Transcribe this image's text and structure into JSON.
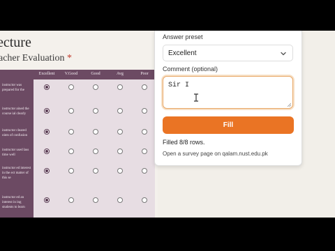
{
  "survey": {
    "title": "ecture",
    "subtitle": "acher Evaluation",
    "required_mark": "*",
    "columns": [
      "Excellent",
      "V.Good",
      "Good",
      "Avg",
      "Poor"
    ],
    "questions": [
      {
        "text": "instructor was prepared for the",
        "selected": "Excellent"
      },
      {
        "text": "instructor ained the course ial clearly",
        "selected": "Excellent"
      },
      {
        "text": "instructor cleared oints of confusion",
        "selected": "Excellent"
      },
      {
        "text": "instructor used lass time well",
        "selected": "Excellent"
      },
      {
        "text": "instructor ed interest in the ect matter of this se",
        "selected": "Excellent"
      },
      {
        "text": "instructor ed an interest in ing students to learn",
        "selected": "Excellent"
      }
    ]
  },
  "panel": {
    "preset_label": "Answer preset",
    "preset_value": "Excellent",
    "comment_label": "Comment (optional)",
    "comment_value": "Sir I",
    "fill_button": "Fill",
    "status": "Filled 8/8 rows.",
    "hint": "Open a survey page on qalam.nust.edu.pk",
    "colors": {
      "accent": "#ea7424",
      "grid_header": "#6c4a63",
      "focus_border": "#e9a766"
    }
  }
}
